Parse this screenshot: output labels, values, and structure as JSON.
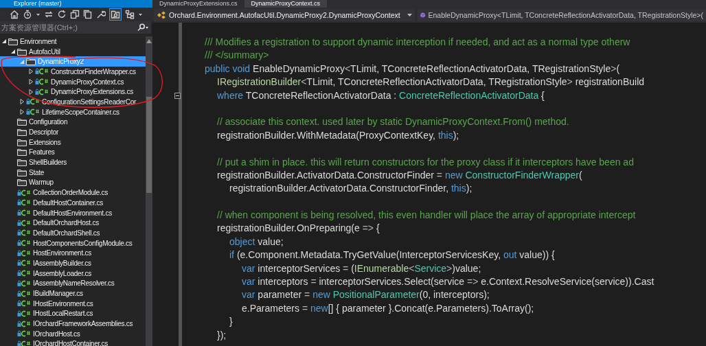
{
  "explorer": {
    "title": "Explorer (master)",
    "toolbar": {
      "preview_toggle": {
        "on": true
      }
    },
    "search": {
      "placeholder": "方案资源管理器(Ctrl+;)"
    },
    "tree": [
      {
        "label": "Environment",
        "kind": "folder",
        "selected": false,
        "expanded": true,
        "children": [
          {
            "label": "AutofacUtil",
            "kind": "folder",
            "selected": false,
            "expanded": true,
            "children": [
              {
                "label": "DynamicProxy2",
                "kind": "folder",
                "selected": true,
                "expanded": true,
                "children": [
                  {
                    "label": "ConstructorFinderWrapper.cs",
                    "kind": "file",
                    "selected": false,
                    "expanded": false
                  },
                  {
                    "label": "DynamicProxyContext.cs",
                    "kind": "file",
                    "selected": false,
                    "expanded": false
                  },
                  {
                    "label": "DynamicProxyExtensions.cs",
                    "kind": "file",
                    "selected": false,
                    "expanded": false
                  }
                ]
              },
              {
                "label": "ConfigurationSettingsReaderCor",
                "kind": "file",
                "selected": false,
                "expanded": false
              },
              {
                "label": "LifetimeScopeContainer.cs",
                "kind": "file",
                "selected": false,
                "expanded": false
              }
            ]
          },
          {
            "label": "Configuration",
            "kind": "folder",
            "selected": false
          },
          {
            "label": "Descriptor",
            "kind": "folder",
            "selected": false
          },
          {
            "label": "Extensions",
            "kind": "folder",
            "selected": false
          },
          {
            "label": "Features",
            "kind": "folder",
            "selected": false
          },
          {
            "label": "ShellBuilders",
            "kind": "folder",
            "selected": false
          },
          {
            "label": "State",
            "kind": "folder",
            "selected": false
          },
          {
            "label": "Warmup",
            "kind": "folder",
            "selected": false
          },
          {
            "label": "CollectionOrderModule.cs",
            "kind": "file",
            "selected": false
          },
          {
            "label": "DefaultHostContainer.cs",
            "kind": "file",
            "selected": false
          },
          {
            "label": "DefaultHostEnvironment.cs",
            "kind": "file",
            "selected": false
          },
          {
            "label": "DefaultOrchardHost.cs",
            "kind": "file",
            "selected": false
          },
          {
            "label": "DefaultOrchardShell.cs",
            "kind": "file",
            "selected": false
          },
          {
            "label": "HostComponentsConfigModule.cs",
            "kind": "file",
            "selected": false
          },
          {
            "label": "HostEnvironment.cs",
            "kind": "file",
            "selected": false
          },
          {
            "label": "IAssemblyBuilder.cs",
            "kind": "file",
            "selected": false
          },
          {
            "label": "IAssemblyLoader.cs",
            "kind": "file",
            "selected": false
          },
          {
            "label": "IAssemblyNameResolver.cs",
            "kind": "file",
            "selected": false
          },
          {
            "label": "IBuildManager.cs",
            "kind": "file",
            "selected": false
          },
          {
            "label": "IHostEnvironment.cs",
            "kind": "file",
            "selected": false
          },
          {
            "label": "IHostLocalRestart.cs",
            "kind": "file",
            "selected": false
          },
          {
            "label": "IOrchardFrameworkAssemblies.cs",
            "kind": "file",
            "selected": false
          },
          {
            "label": "IOrchardHost.cs",
            "kind": "file",
            "selected": false
          },
          {
            "label": "IOrchardHostContainer.cs",
            "kind": "file",
            "selected": false
          }
        ]
      }
    ]
  },
  "editor": {
    "tabs": [
      {
        "label": "DynamicProxyExtensions.cs",
        "selected": false
      },
      {
        "label": "DynamicProxyContext.cs",
        "selected": true
      }
    ],
    "nav": {
      "type_path": "Orchard.Environment.AutofacUtil.DynamicProxy2.DynamicProxyContext",
      "member": "EnableDynamicProxy<TLimit, TConcreteReflectionActivatorData, TRegistrationStyle>("
    },
    "lines": [
      {
        "kind": "code",
        "tokens": [
          {
            "text": "\t/// Modifies a registration to support dynamic interception if needed, and act as a normal type otherw",
            "kind": "comment"
          }
        ]
      },
      {
        "kind": "code",
        "tokens": [
          {
            "text": "\t/// </summary>",
            "kind": "comment"
          }
        ]
      },
      {
        "kind": "code",
        "tokens": [
          {
            "text": "\tpublic void ",
            "kind": "keyword"
          },
          {
            "text": "EnableDynamicProxy",
            "kind": "plain"
          },
          {
            "text": "<",
            "kind": "operator"
          },
          {
            "text": "TLimit, TConcreteReflectionActivatorData, TRegistrationStyle",
            "kind": "plain"
          },
          {
            "text": ">",
            "kind": "operator"
          },
          {
            "text": "(",
            "kind": "plain"
          }
        ]
      },
      {
        "kind": "code",
        "tokens": [
          {
            "text": "\t\tIRegistrationBuilder",
            "kind": "interface"
          },
          {
            "text": "<",
            "kind": "operator"
          },
          {
            "text": "TLimit, TConcreteReflectionActivatorData, TRegistrationStyle",
            "kind": "plain"
          },
          {
            "text": ">",
            "kind": "operator"
          },
          {
            "text": " registrationBuild",
            "kind": "plain"
          }
        ]
      },
      {
        "kind": "code",
        "fold": true,
        "tokens": [
          {
            "text": "\t\twhere ",
            "kind": "keyword"
          },
          {
            "text": "TConcreteReflectionActivatorData : ",
            "kind": "plain"
          },
          {
            "text": "ConcreteReflectionActivatorData",
            "kind": "type"
          },
          {
            "text": " {",
            "kind": "plain"
          }
        ]
      },
      {
        "kind": "blank"
      },
      {
        "kind": "code",
        "tokens": [
          {
            "text": "\t\t// associate this context. used later by static DynamicProxyContext.From() method.",
            "kind": "comment"
          }
        ]
      },
      {
        "kind": "code",
        "tokens": [
          {
            "text": "\t\tregistrationBuilder.WithMetadata(ProxyContextKey, ",
            "kind": "plain"
          },
          {
            "text": "this",
            "kind": "keyword"
          },
          {
            "text": ");",
            "kind": "plain"
          }
        ]
      },
      {
        "kind": "blank"
      },
      {
        "kind": "code",
        "tokens": [
          {
            "text": "\t\t// put a shim in place. this will return constructors for the proxy class if it interceptors have been ad",
            "kind": "comment"
          }
        ]
      },
      {
        "kind": "code",
        "tokens": [
          {
            "text": "\t\tregistrationBuilder.ActivatorData.ConstructorFinder ",
            "kind": "plain"
          },
          {
            "text": "= ",
            "kind": "operator"
          },
          {
            "text": "new ",
            "kind": "keyword"
          },
          {
            "text": "ConstructorFinderWrapper",
            "kind": "type"
          },
          {
            "text": "(",
            "kind": "plain"
          }
        ]
      },
      {
        "kind": "code",
        "tokens": [
          {
            "text": "\t\t\tregistrationBuilder.ActivatorData.ConstructorFinder, ",
            "kind": "plain"
          },
          {
            "text": "this",
            "kind": "keyword"
          },
          {
            "text": ");",
            "kind": "plain"
          }
        ]
      },
      {
        "kind": "blank"
      },
      {
        "kind": "code",
        "tokens": [
          {
            "text": "\t\t// when component is being resolved, this even handler will place the array of appropriate intercept",
            "kind": "comment"
          }
        ]
      },
      {
        "kind": "code",
        "tokens": [
          {
            "text": "\t\tregistrationBuilder.OnPreparing(e ",
            "kind": "plain"
          },
          {
            "text": "=>",
            "kind": "operator"
          },
          {
            "text": " {",
            "kind": "plain"
          }
        ]
      },
      {
        "kind": "code",
        "tokens": [
          {
            "text": "\t\t\tobject",
            "kind": "keyword"
          },
          {
            "text": " value;",
            "kind": "plain"
          }
        ]
      },
      {
        "kind": "code",
        "tokens": [
          {
            "text": "\t\t\tif",
            "kind": "keyword"
          },
          {
            "text": " (e.Component.Metadata.TryGetValue(InterceptorServicesKey, ",
            "kind": "plain"
          },
          {
            "text": "out",
            "kind": "keyword"
          },
          {
            "text": " value)) {",
            "kind": "plain"
          }
        ]
      },
      {
        "kind": "code",
        "tokens": [
          {
            "text": "\t\t\t\tvar",
            "kind": "keyword"
          },
          {
            "text": " interceptorServices ",
            "kind": "plain"
          },
          {
            "text": "= ",
            "kind": "operator"
          },
          {
            "text": "(",
            "kind": "plain"
          },
          {
            "text": "IEnumerable",
            "kind": "interface"
          },
          {
            "text": "<",
            "kind": "operator"
          },
          {
            "text": "Service",
            "kind": "type"
          },
          {
            "text": ">",
            "kind": "operator"
          },
          {
            "text": ")value;",
            "kind": "plain"
          }
        ]
      },
      {
        "kind": "code",
        "tokens": [
          {
            "text": "\t\t\t\tvar",
            "kind": "keyword"
          },
          {
            "text": " interceptors ",
            "kind": "plain"
          },
          {
            "text": "=",
            "kind": "operator"
          },
          {
            "text": " interceptorServices.Select(service ",
            "kind": "plain"
          },
          {
            "text": "=>",
            "kind": "operator"
          },
          {
            "text": " e.Context.ResolveService(service)).Cast",
            "kind": "plain"
          }
        ]
      },
      {
        "kind": "code",
        "tokens": [
          {
            "text": "\t\t\t\tvar",
            "kind": "keyword"
          },
          {
            "text": " parameter ",
            "kind": "plain"
          },
          {
            "text": "= ",
            "kind": "operator"
          },
          {
            "text": "new ",
            "kind": "keyword"
          },
          {
            "text": "PositionalParameter",
            "kind": "type"
          },
          {
            "text": "(0, interceptors);",
            "kind": "plain"
          }
        ]
      },
      {
        "kind": "code",
        "tokens": [
          {
            "text": "\t\t\t\te.Parameters ",
            "kind": "plain"
          },
          {
            "text": "= ",
            "kind": "operator"
          },
          {
            "text": "new",
            "kind": "keyword"
          },
          {
            "text": "[] { parameter }.Concat(e.Parameters).ToArray();",
            "kind": "plain"
          }
        ]
      },
      {
        "kind": "code",
        "tokens": [
          {
            "text": "\t\t\t}",
            "kind": "plain"
          }
        ]
      },
      {
        "kind": "code",
        "tokens": [
          {
            "text": "\t\t});",
            "kind": "plain"
          }
        ]
      }
    ]
  }
}
